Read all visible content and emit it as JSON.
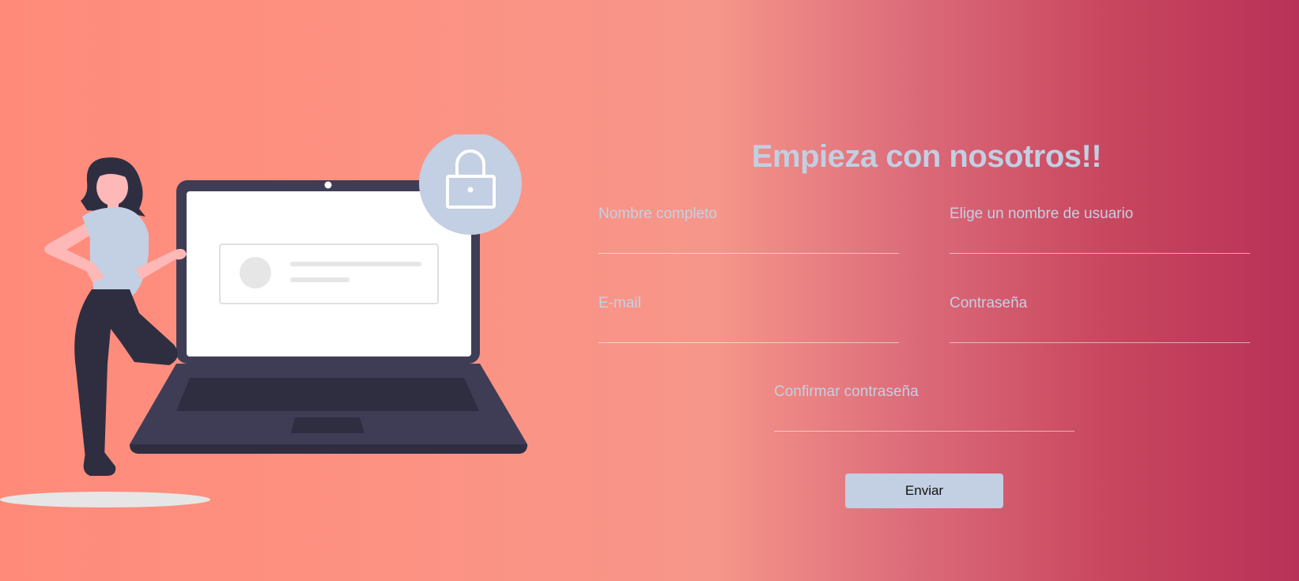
{
  "title": "Empieza con nosotros!!",
  "fields": {
    "full_name": {
      "label": "Nombre completo",
      "value": ""
    },
    "username": {
      "label": "Elige un nombre de usuario",
      "value": ""
    },
    "email": {
      "label": "E-mail",
      "value": ""
    },
    "password": {
      "label": "Contraseña",
      "value": ""
    },
    "confirm_password": {
      "label": "Confirmar contraseña",
      "value": ""
    }
  },
  "submit_label": "Enviar",
  "colors": {
    "gradient_start": "#ff8a7a",
    "gradient_end": "#b83158",
    "accent": "#c3cfe2",
    "laptop": "#3f3d56",
    "figure_dark": "#2f2e41",
    "skin": "#ffb8b8"
  },
  "icons": {
    "lock": "lock-icon",
    "illustration": "woman-with-laptop-illustration"
  }
}
